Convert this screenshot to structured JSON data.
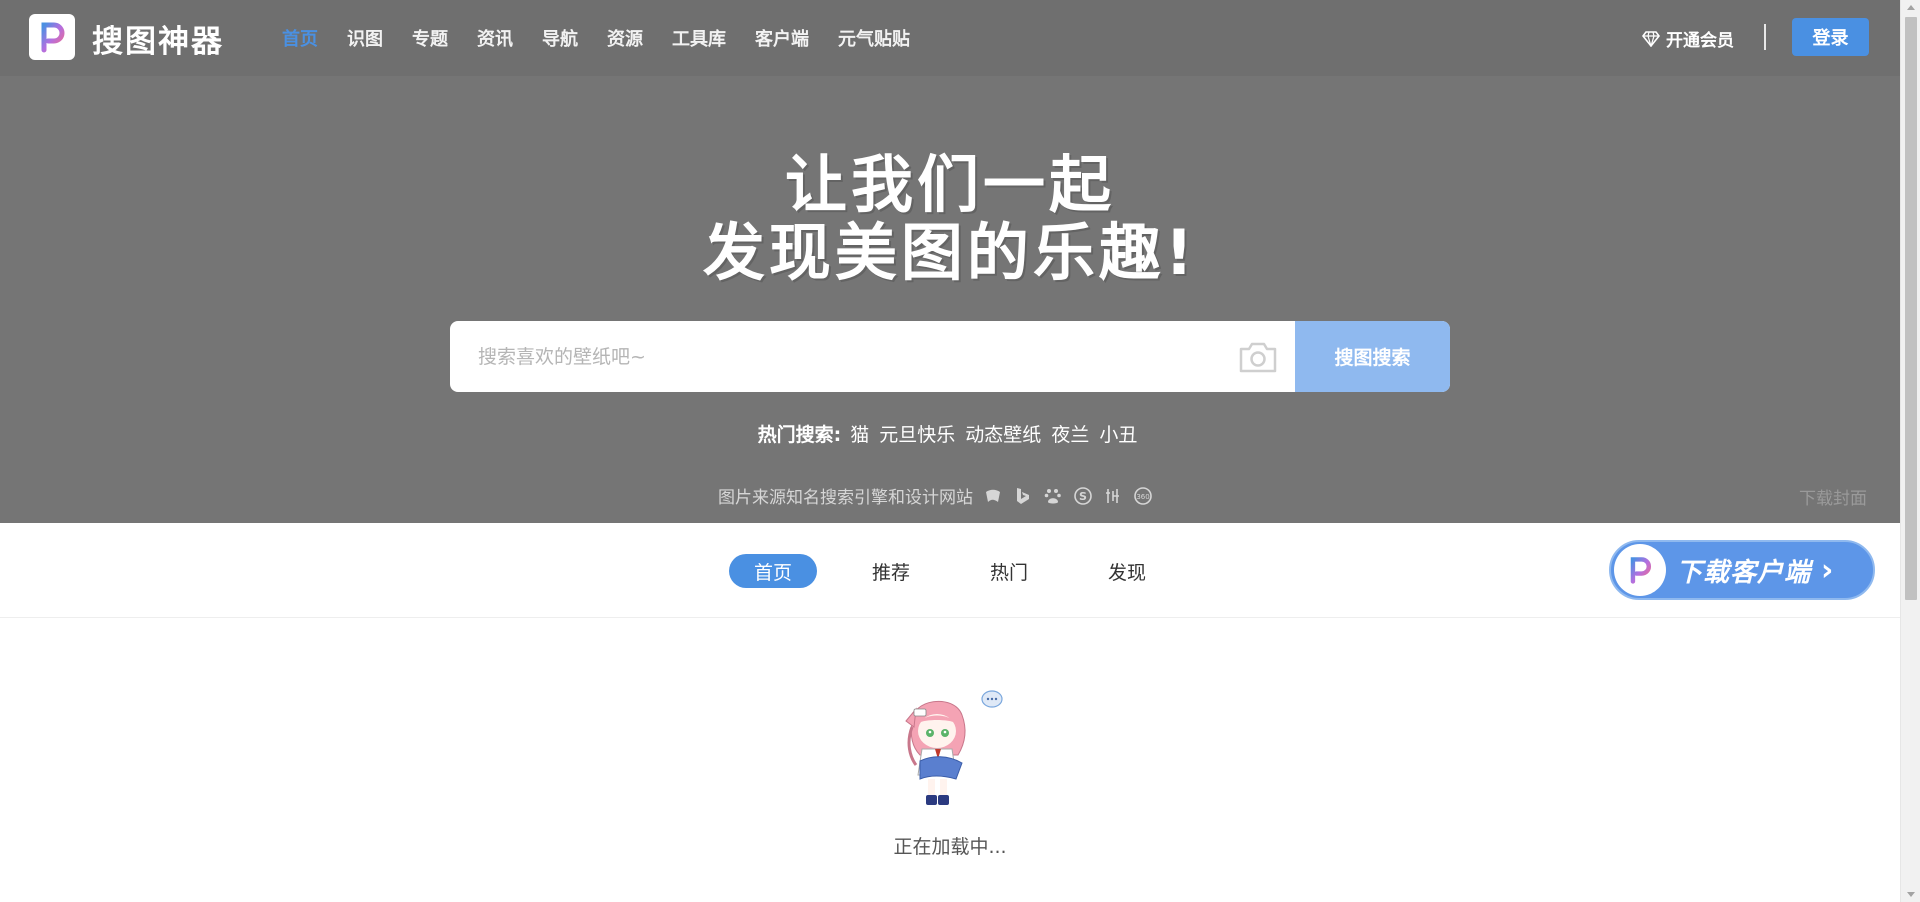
{
  "header": {
    "brand_name": "搜图神器",
    "nav_items": [
      "首页",
      "识图",
      "专题",
      "资讯",
      "导航",
      "资源",
      "工具库",
      "客户端",
      "元气贴贴"
    ],
    "vip_label": "开通会员",
    "login_label": "登录"
  },
  "hero": {
    "slogan_line1": "让我们一起",
    "slogan_line2": "发现美图的乐趣!",
    "search": {
      "placeholder": "搜索喜欢的壁纸吧~",
      "button_label": "搜图搜索"
    },
    "hot": {
      "label": "热门搜索:",
      "keywords": [
        "猫",
        "元旦快乐",
        "动态壁纸",
        "夜兰",
        "小丑"
      ]
    },
    "source_text": "图片来源知名搜索引擎和设计网站",
    "download_cover": "下载封面"
  },
  "tabs": {
    "items": [
      "首页",
      "推荐",
      "热门",
      "发现"
    ],
    "download_client": "下载客户端"
  },
  "loading": {
    "text": "正在加载中..."
  },
  "colors": {
    "accent": "#4a90e2",
    "hero_bg": "#757575",
    "search_button": "#8fb9ef"
  }
}
